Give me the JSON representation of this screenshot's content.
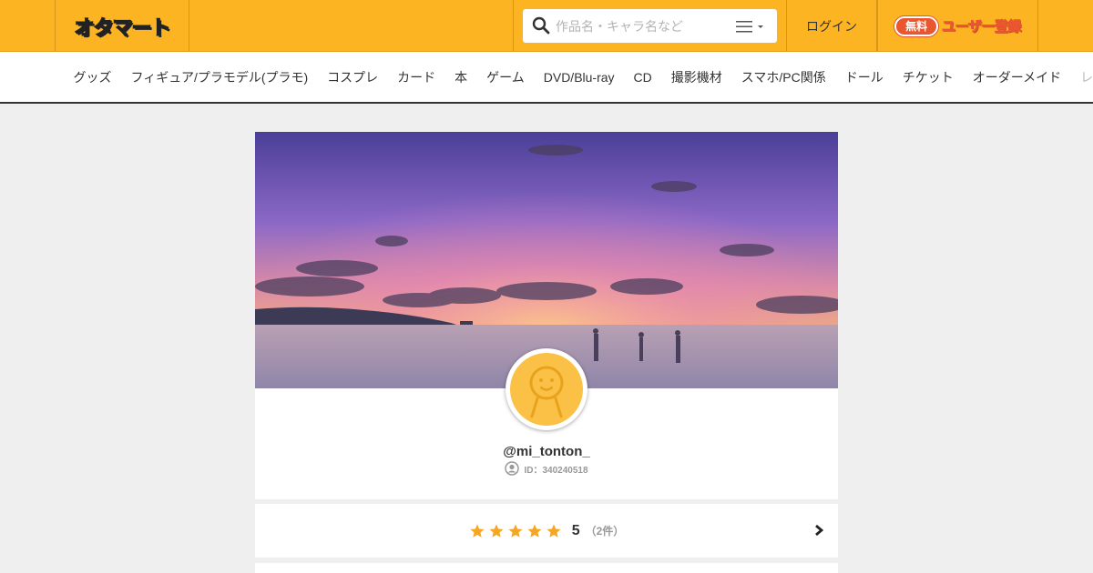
{
  "header": {
    "logo_text": "オタマート",
    "search": {
      "placeholder": "作品名・キャラ名など"
    },
    "login_label": "ログイン",
    "register": {
      "badge": "無料",
      "label": "ユーザー登録"
    }
  },
  "categories": [
    "グッズ",
    "フィギュア/プラモデル(プラモ)",
    "コスプレ",
    "カード",
    "本",
    "ゲーム",
    "DVD/Blu-ray",
    "CD",
    "撮影機材",
    "スマホ/PC関係",
    "ドール",
    "チケット",
    "オーダーメイド",
    "レ"
  ],
  "profile": {
    "username": "@mi_tonton_",
    "user_id_label": "ID：340240518"
  },
  "rating": {
    "stars": 5,
    "score": "5",
    "count": "（2件）"
  },
  "colors": {
    "brand": "#fcb423",
    "accent": "#e9562f",
    "star": "#f5a623"
  },
  "icons": {
    "search": "search-icon",
    "menu": "menu-icon",
    "id": "user-circle-icon",
    "star": "star-icon",
    "chevron": "chevron-right-icon"
  }
}
